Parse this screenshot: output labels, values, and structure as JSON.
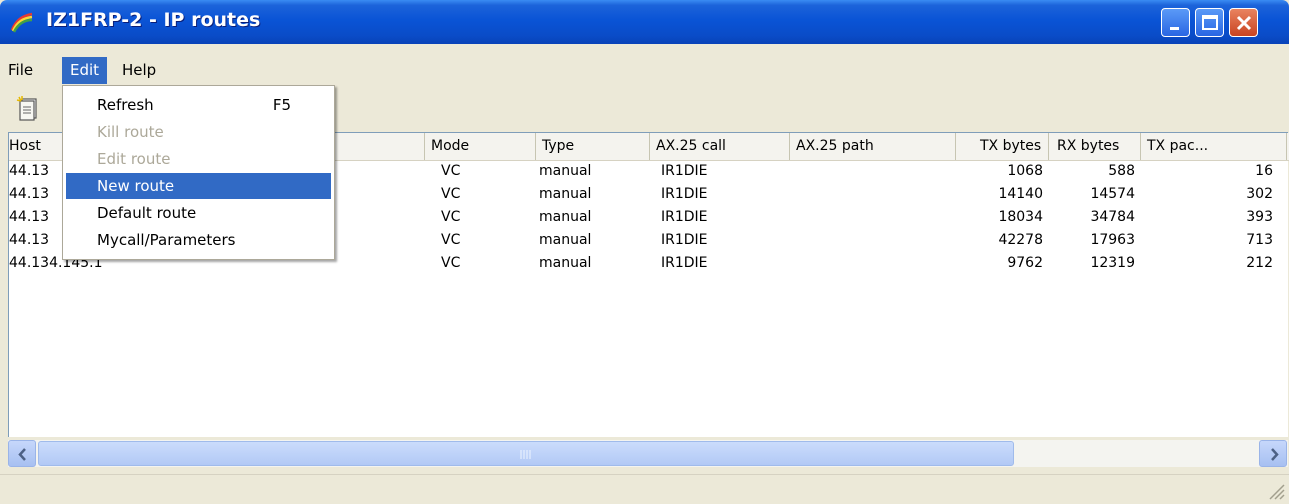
{
  "window": {
    "title": "IZ1FRP-2 - IP routes"
  },
  "menubar": {
    "file": "File",
    "edit": "Edit",
    "help": "Help"
  },
  "edit_menu": {
    "refresh": "Refresh",
    "refresh_shortcut": "F5",
    "kill_route": "Kill route",
    "edit_route": "Edit route",
    "new_route": "New route",
    "default_route": "Default route",
    "mycall": "Mycall/Parameters"
  },
  "columns": {
    "host": "Host",
    "mode": "Mode",
    "type": "Type",
    "ax25_call": "AX.25 call",
    "ax25_path": "AX.25 path",
    "tx_bytes": "TX bytes",
    "rx_bytes": "RX bytes",
    "tx_packets": "TX pac..."
  },
  "rows": [
    {
      "host": "44.13",
      "mode": "VC",
      "type": "manual",
      "call": "IR1DIE",
      "path": "",
      "tx_bytes": "1068",
      "rx_bytes": "588",
      "tx_packets": "16"
    },
    {
      "host": "44.13",
      "mode": "VC",
      "type": "manual",
      "call": "IR1DIE",
      "path": "",
      "tx_bytes": "14140",
      "rx_bytes": "14574",
      "tx_packets": "302"
    },
    {
      "host": "44.13",
      "mode": "VC",
      "type": "manual",
      "call": "IR1DIE",
      "path": "",
      "tx_bytes": "18034",
      "rx_bytes": "34784",
      "tx_packets": "393"
    },
    {
      "host": "44.13",
      "mode": "VC",
      "type": "manual",
      "call": "IR1DIE",
      "path": "",
      "tx_bytes": "42278",
      "rx_bytes": "17963",
      "tx_packets": "713"
    },
    {
      "host": "44.134.145.1",
      "mode": "VC",
      "type": "manual",
      "call": "IR1DIE",
      "path": "",
      "tx_bytes": "9762",
      "rx_bytes": "12319",
      "tx_packets": "212"
    }
  ],
  "colors": {
    "titlebar": "#0A54D6",
    "menu_highlight": "#316AC5",
    "window_bg": "#ECE9D8"
  }
}
